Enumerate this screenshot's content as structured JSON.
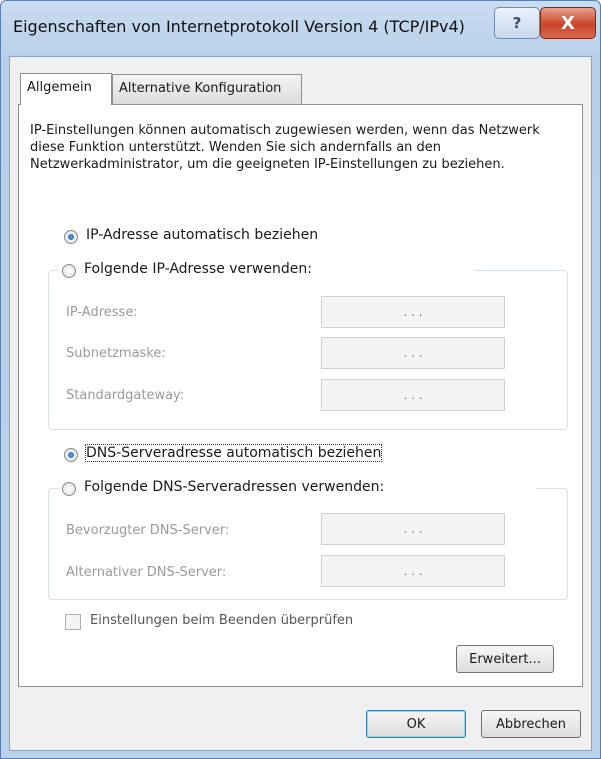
{
  "window": {
    "title": "Eigenschaften von Internetprotokoll Version 4 (TCP/IPv4)",
    "help_symbol": "?",
    "close_symbol": "X"
  },
  "tabs": [
    {
      "label": "Allgemein",
      "active": true
    },
    {
      "label": "Alternative Konfiguration",
      "active": false
    }
  ],
  "description": "IP-Einstellungen können automatisch zugewiesen werden, wenn das Netzwerk diese Funktion unterstützt. Wenden Sie sich andernfalls an den Netzwerkadministrator, um die geeigneten IP-Einstellungen zu beziehen.",
  "ip": {
    "auto_label": "IP-Adresse automatisch beziehen",
    "auto_selected": true,
    "manual_label": "Folgende IP-Adresse verwenden:",
    "fields": [
      {
        "label": "IP-Adresse:",
        "value": ". . ."
      },
      {
        "label": "Subnetzmaske:",
        "value": ". . ."
      },
      {
        "label": "Standardgateway:",
        "value": ". . ."
      }
    ]
  },
  "dns": {
    "auto_label": "DNS-Serveradresse automatisch beziehen",
    "auto_selected": true,
    "manual_label": "Folgende DNS-Serveradressen verwenden:",
    "fields": [
      {
        "label": "Bevorzugter DNS-Server:",
        "value": ". . ."
      },
      {
        "label": "Alternativer DNS-Server:",
        "value": ". . ."
      }
    ]
  },
  "validate_checkbox": {
    "label": "Einstellungen beim Beenden überprüfen",
    "checked": false
  },
  "buttons": {
    "advanced": "Erweitert...",
    "ok": "OK",
    "cancel": "Abbrechen"
  }
}
